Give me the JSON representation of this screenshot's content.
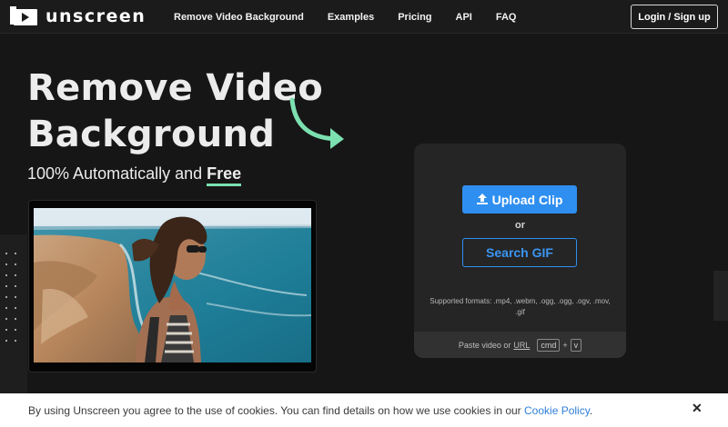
{
  "nav": {
    "logo_text": "unscreen",
    "links": [
      "Remove Video Background",
      "Examples",
      "Pricing",
      "API",
      "FAQ"
    ],
    "login_label": "Login / Sign up"
  },
  "hero": {
    "title": "Remove Video Background",
    "subtitle_prefix": "100% Automatically and",
    "subtitle_emphasis": "Free"
  },
  "upload": {
    "upload_label": "Upload Clip",
    "or_label": "or",
    "search_label": "Search GIF",
    "formats_text": "Supported formats: .mp4, .webm, .ogg, .ogg, .ogv, .mov, .gif",
    "paste_prefix": "Paste video or",
    "paste_url": "URL",
    "kbd_cmd": "cmd",
    "kbd_plus": "+",
    "kbd_v": "v"
  },
  "cookie": {
    "text": "By using Unscreen you agree to the use of cookies. You can find details on how we use cookies in our",
    "link": "Cookie Policy",
    "period": ".",
    "close": "✕"
  },
  "colors": {
    "accent_blue": "#2f8ff0",
    "accent_green": "#7cdfb0",
    "background": "#161616"
  },
  "icons": [
    "logo-play-icon",
    "upload-icon",
    "curved-arrow-icon",
    "close-icon"
  ]
}
